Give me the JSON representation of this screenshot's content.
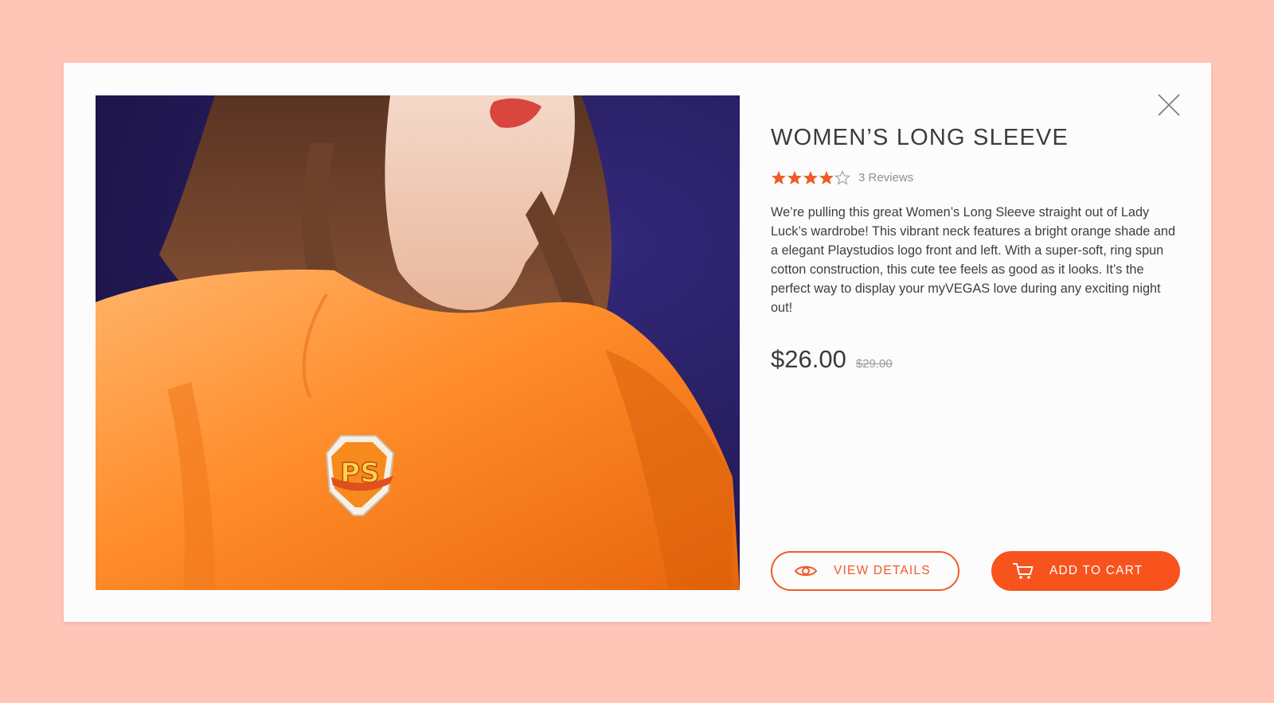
{
  "product": {
    "title": "WOMEN’S LONG SLEEVE",
    "rating": 4,
    "rating_max": 5,
    "reviews_label": "3 Reviews",
    "description": "We’re pulling this great Women’s Long Sleeve straight out of Lady Luck’s wardrobe! This vibrant neck features a bright orange shade and a elegant Playstudios logo front and left. With a super-soft, ring spun cotton construction, this cute tee feels as good as it looks. It’s the perfect way to display your myVEGAS love during any exciting night out!",
    "price": "$26.00",
    "original_price": "$29.00"
  },
  "buttons": {
    "view_details": "VIEW DETAILS",
    "add_to_cart": "ADD TO CART"
  },
  "icons": {
    "close": "close-icon",
    "view": "eye-icon",
    "cart": "cart-icon",
    "star": "star-icon"
  },
  "colors": {
    "background": "#ffc5b6",
    "accent": "#f8521d",
    "star": "#f25a26",
    "text": "#3e3e3e"
  }
}
